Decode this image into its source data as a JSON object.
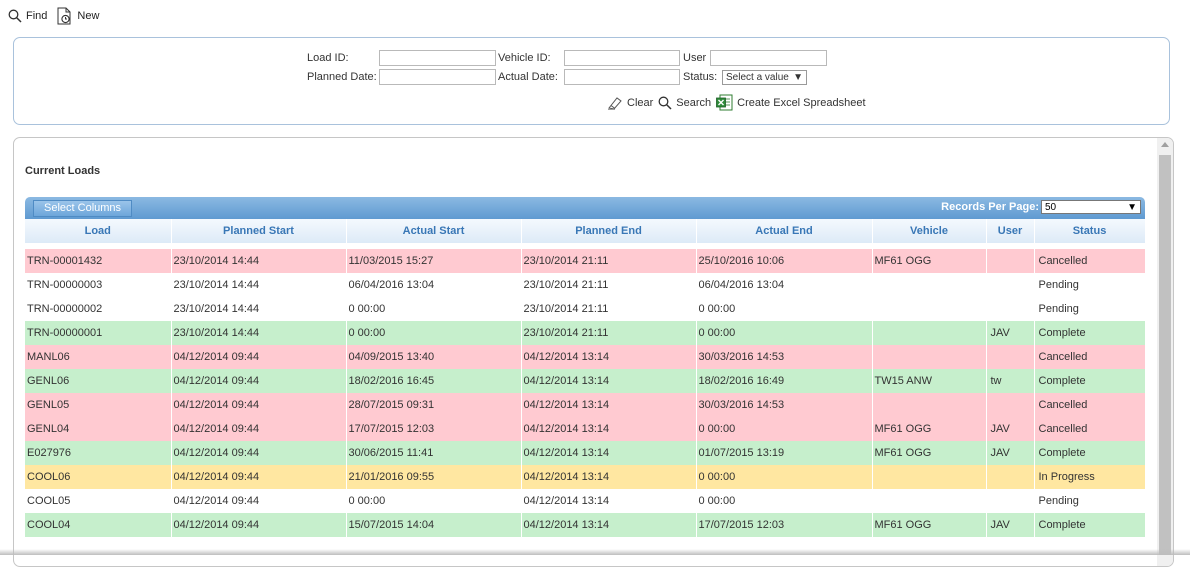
{
  "toolbar": {
    "find_label": "Find",
    "new_label": "New"
  },
  "filters": {
    "load_id_label": "Load ID:",
    "vehicle_id_label": "Vehicle ID:",
    "user_id_label": "User Id:",
    "planned_date_label": "Planned Date:",
    "actual_date_label": "Actual Date:",
    "status_label": "Status:",
    "status_value": "Select a value",
    "load_id_value": "",
    "vehicle_id_value": "",
    "user_id_value": "",
    "planned_date_value": "",
    "actual_date_value": ""
  },
  "actions": {
    "clear_label": "Clear",
    "search_label": "Search",
    "excel_label": "Create Excel Spreadsheet"
  },
  "panel": {
    "title": "Current Loads",
    "select_columns_label": "Select Columns",
    "records_per_page_label": "Records Per Page:",
    "records_per_page_value": "50"
  },
  "columns": [
    "Load",
    "Planned Start",
    "Actual Start",
    "Planned End",
    "Actual End",
    "Vehicle",
    "User",
    "Status"
  ],
  "status_colors": {
    "Cancelled": "#ffcad1",
    "Complete": "#c6efcc",
    "In Progress": "#ffe7a1",
    "Pending": "#ffffff"
  },
  "rows": [
    {
      "load": "TRN-00001432",
      "planned_start": "23/10/2014 14:44",
      "actual_start": "11/03/2015 15:27",
      "planned_end": "23/10/2014 21:11",
      "actual_end": "25/10/2016 10:06",
      "vehicle": "MF61 OGG",
      "user": "",
      "status": "Cancelled"
    },
    {
      "load": "TRN-00000003",
      "planned_start": "23/10/2014 14:44",
      "actual_start": "06/04/2016 13:04",
      "planned_end": "23/10/2014 21:11",
      "actual_end": "06/04/2016 13:04",
      "vehicle": "",
      "user": "",
      "status": "Pending"
    },
    {
      "load": "TRN-00000002",
      "planned_start": "23/10/2014 14:44",
      "actual_start": "0 00:00",
      "planned_end": "23/10/2014 21:11",
      "actual_end": "0 00:00",
      "vehicle": "",
      "user": "",
      "status": "Pending"
    },
    {
      "load": "TRN-00000001",
      "planned_start": "23/10/2014 14:44",
      "actual_start": "0 00:00",
      "planned_end": "23/10/2014 21:11",
      "actual_end": "0 00:00",
      "vehicle": "",
      "user": "JAV",
      "status": "Complete"
    },
    {
      "load": "MANL06",
      "planned_start": "04/12/2014 09:44",
      "actual_start": "04/09/2015 13:40",
      "planned_end": "04/12/2014 13:14",
      "actual_end": "30/03/2016 14:53",
      "vehicle": "",
      "user": "",
      "status": "Cancelled"
    },
    {
      "load": "GENL06",
      "planned_start": "04/12/2014 09:44",
      "actual_start": "18/02/2016 16:45",
      "planned_end": "04/12/2014 13:14",
      "actual_end": "18/02/2016 16:49",
      "vehicle": "TW15 ANW",
      "user": "tw",
      "status": "Complete"
    },
    {
      "load": "GENL05",
      "planned_start": "04/12/2014 09:44",
      "actual_start": "28/07/2015 09:31",
      "planned_end": "04/12/2014 13:14",
      "actual_end": "30/03/2016 14:53",
      "vehicle": "",
      "user": "",
      "status": "Cancelled"
    },
    {
      "load": "GENL04",
      "planned_start": "04/12/2014 09:44",
      "actual_start": "17/07/2015 12:03",
      "planned_end": "04/12/2014 13:14",
      "actual_end": "0 00:00",
      "vehicle": "MF61 OGG",
      "user": "JAV",
      "status": "Cancelled"
    },
    {
      "load": "E027976",
      "planned_start": "04/12/2014 09:44",
      "actual_start": "30/06/2015 11:41",
      "planned_end": "04/12/2014 13:14",
      "actual_end": "01/07/2015 13:19",
      "vehicle": "MF61 OGG",
      "user": "JAV",
      "status": "Complete"
    },
    {
      "load": "COOL06",
      "planned_start": "04/12/2014 09:44",
      "actual_start": "21/01/2016 09:55",
      "planned_end": "04/12/2014 13:14",
      "actual_end": "0 00:00",
      "vehicle": "",
      "user": "",
      "status": "In Progress"
    },
    {
      "load": "COOL05",
      "planned_start": "04/12/2014 09:44",
      "actual_start": "0 00:00",
      "planned_end": "04/12/2014 13:14",
      "actual_end": "0 00:00",
      "vehicle": "",
      "user": "",
      "status": "Pending"
    },
    {
      "load": "COOL04",
      "planned_start": "04/12/2014 09:44",
      "actual_start": "15/07/2015 14:04",
      "planned_end": "04/12/2014 13:14",
      "actual_end": "17/07/2015 12:03",
      "vehicle": "MF61 OGG",
      "user": "JAV",
      "status": "Complete"
    }
  ]
}
